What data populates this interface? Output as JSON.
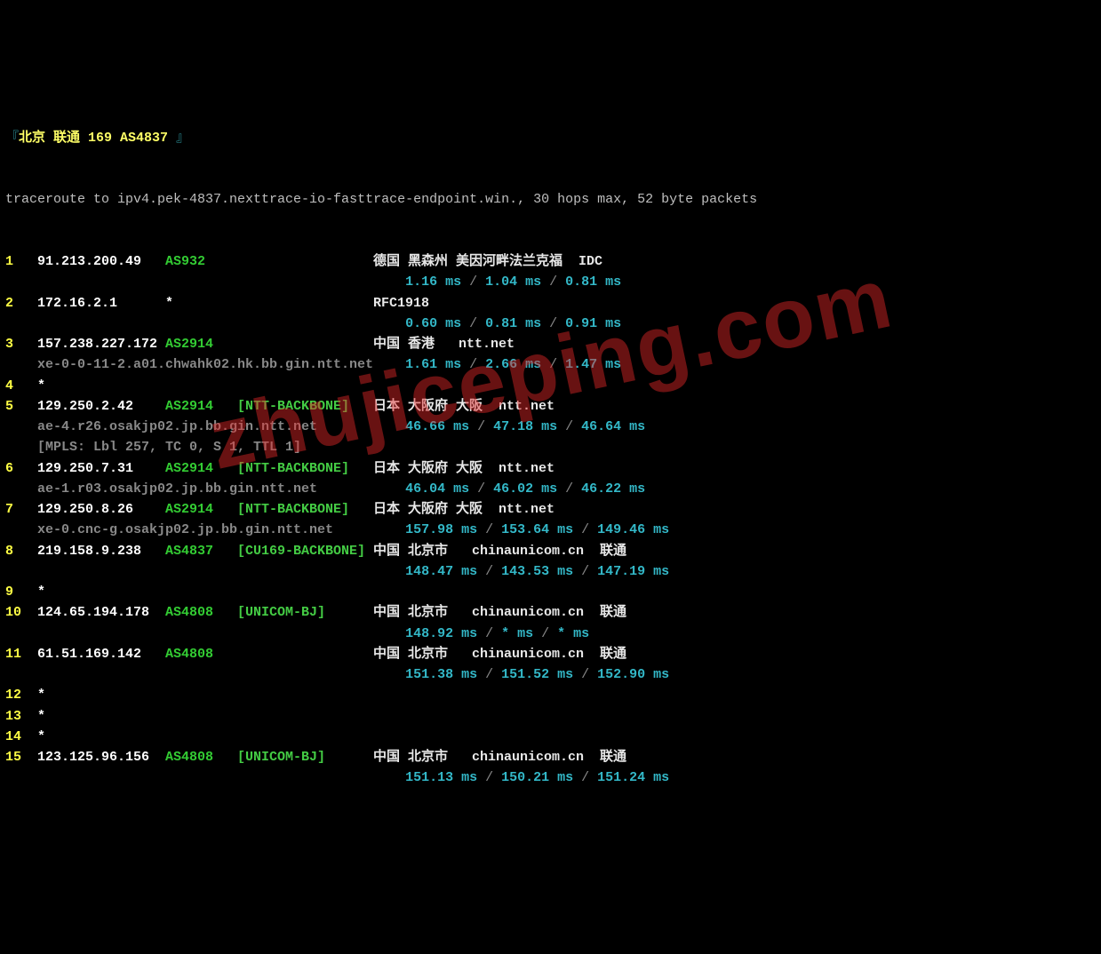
{
  "header": {
    "lb": "『",
    "rb": " 』",
    "label": "北京 联通 ",
    "code": "169 ",
    "asn": "AS4837"
  },
  "cmd": "traceroute to ipv4.pek-4837.nexttrace-io-fasttrace-endpoint.win., 30 hops max, 52 byte packets",
  "watermark": "zhujiceping.com",
  "hops": [
    {
      "n": "1",
      "ip": "91.213.200.49",
      "asn": "AS932",
      "org": "",
      "loc": "德国 黑森州 美因河畔法兰克福  IDC",
      "rtt": [
        "1.16 ms",
        "1.04 ms",
        "0.81 ms"
      ]
    },
    {
      "n": "2",
      "ip": "172.16.2.1",
      "asn": "*",
      "org": "",
      "loc": "RFC1918",
      "rtt": [
        "0.60 ms",
        "0.81 ms",
        "0.91 ms"
      ]
    },
    {
      "n": "3",
      "ip": "157.238.227.172",
      "asn": "AS2914",
      "org": "",
      "loc": "中国 香港   ntt.net",
      "rdns": "xe-0-0-11-2.a01.chwahk02.hk.bb.gin.ntt.net",
      "rtt": [
        "1.61 ms",
        "2.66 ms",
        "1.47 ms"
      ]
    },
    {
      "n": "4",
      "timeout": true
    },
    {
      "n": "5",
      "ip": "129.250.2.42",
      "asn": "AS2914",
      "org": "[NTT-BACKBONE]",
      "loc": "日本 大阪府 大阪  ntt.net",
      "rdns": "ae-4.r26.osakjp02.jp.bb.gin.ntt.net",
      "mpls": "[MPLS: Lbl 257, TC 0, S 1, TTL 1]",
      "rtt": [
        "46.66 ms",
        "47.18 ms",
        "46.64 ms"
      ]
    },
    {
      "n": "6",
      "ip": "129.250.7.31",
      "asn": "AS2914",
      "org": "[NTT-BACKBONE]",
      "loc": "日本 大阪府 大阪  ntt.net",
      "rdns": "ae-1.r03.osakjp02.jp.bb.gin.ntt.net",
      "rtt": [
        "46.04 ms",
        "46.02 ms",
        "46.22 ms"
      ]
    },
    {
      "n": "7",
      "ip": "129.250.8.26",
      "asn": "AS2914",
      "org": "[NTT-BACKBONE]",
      "loc": "日本 大阪府 大阪  ntt.net",
      "rdns": "xe-0.cnc-g.osakjp02.jp.bb.gin.ntt.net",
      "rtt": [
        "157.98 ms",
        "153.64 ms",
        "149.46 ms"
      ]
    },
    {
      "n": "8",
      "ip": "219.158.9.238",
      "asn": "AS4837",
      "org": "[CU169-BACKBONE]",
      "loc": "中国 北京市   chinaunicom.cn  联通",
      "rtt": [
        "148.47 ms",
        "143.53 ms",
        "147.19 ms"
      ]
    },
    {
      "n": "9",
      "timeout": true
    },
    {
      "n": "10",
      "ip": "124.65.194.178",
      "asn": "AS4808",
      "org": "[UNICOM-BJ]",
      "loc": "中国 北京市   chinaunicom.cn  联通",
      "rtt": [
        "148.92 ms",
        "* ms",
        "* ms"
      ]
    },
    {
      "n": "11",
      "ip": "61.51.169.142",
      "asn": "AS4808",
      "org": "",
      "loc": "中国 北京市   chinaunicom.cn  联通",
      "rtt": [
        "151.38 ms",
        "151.52 ms",
        "152.90 ms"
      ]
    },
    {
      "n": "12",
      "timeout": true
    },
    {
      "n": "13",
      "timeout": true
    },
    {
      "n": "14",
      "timeout": true
    },
    {
      "n": "15",
      "ip": "123.125.96.156",
      "asn": "AS4808",
      "org": "[UNICOM-BJ]",
      "loc": "中国 北京市   chinaunicom.cn  联通",
      "rtt": [
        "151.13 ms",
        "150.21 ms",
        "151.24 ms"
      ]
    }
  ]
}
